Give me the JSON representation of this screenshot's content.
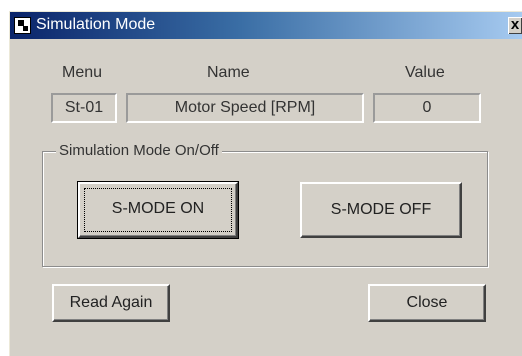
{
  "window": {
    "title": "Simulation Mode",
    "icon": "app-icon",
    "close_label": "x"
  },
  "columns": {
    "menu": "Menu",
    "name": "Name",
    "value": "Value"
  },
  "row": {
    "menu": "St-01",
    "name": "Motor Speed [RPM]",
    "value": "0"
  },
  "group": {
    "title": "Simulation Mode On/Off",
    "on_label": "S-MODE ON",
    "off_label": "S-MODE OFF"
  },
  "footer": {
    "read_again_label": "Read Again",
    "close_label": "Close"
  }
}
